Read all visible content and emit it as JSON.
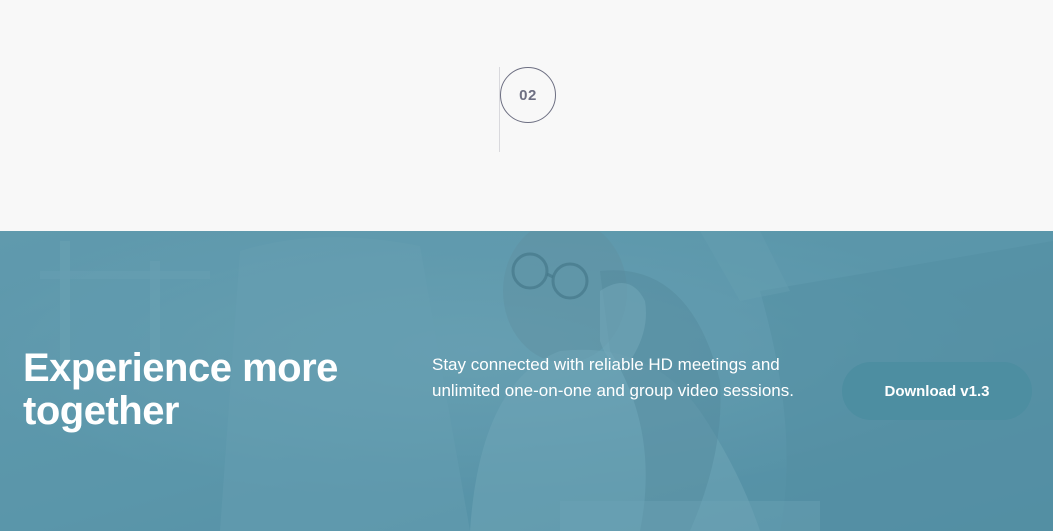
{
  "step": {
    "number": "02"
  },
  "hero": {
    "title": "Experience more together",
    "description": "Stay connected with reliable HD meetings and unlimited one-on-one and group video sessions.",
    "download_label": "Download v1.3",
    "background_image": "woman-with-glasses-on-phone-photo",
    "overlay_color": "#5894a8",
    "button_color": "#4d8ea1"
  }
}
